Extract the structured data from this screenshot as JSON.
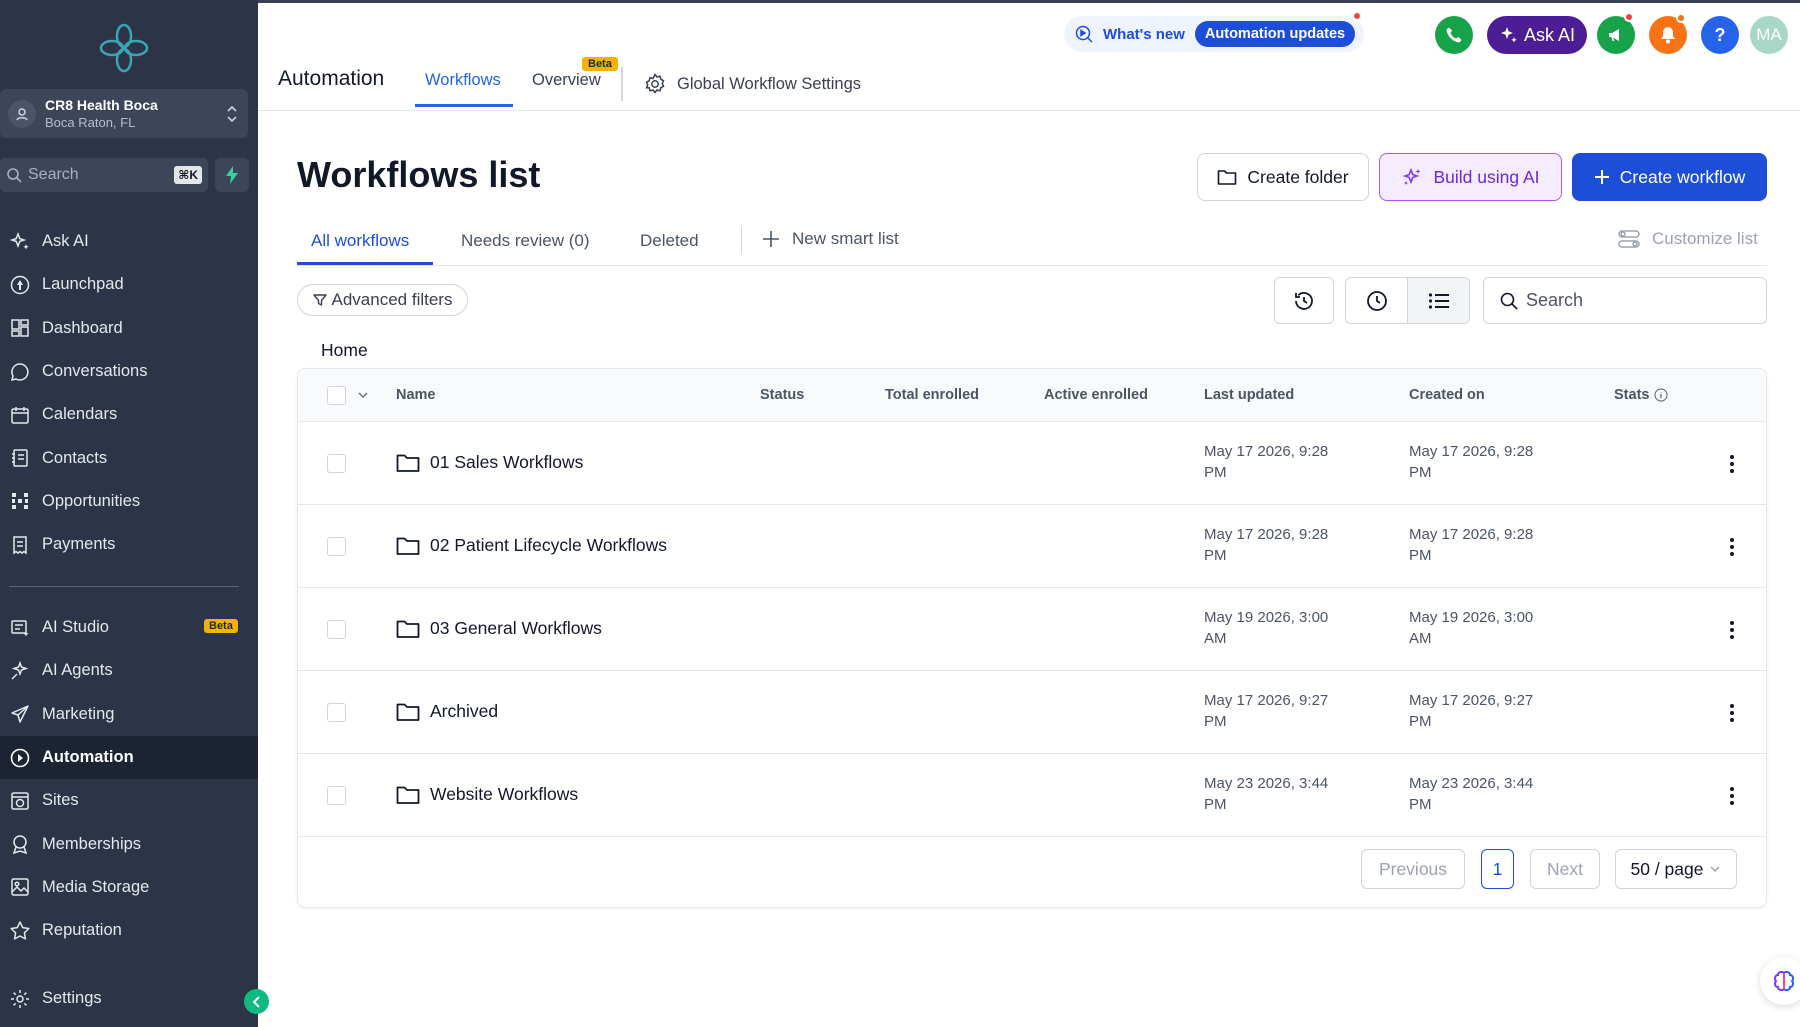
{
  "sidebar": {
    "location": {
      "name": "CR8 Health Boca",
      "city": "Boca Raton, FL"
    },
    "search": {
      "label": "Search",
      "shortcut": "⌘K"
    },
    "items": [
      {
        "label": "Ask AI",
        "icon": "sparkles-icon"
      },
      {
        "label": "Launchpad",
        "icon": "rocket-icon"
      },
      {
        "label": "Dashboard",
        "icon": "dashboard-grid-icon"
      },
      {
        "label": "Conversations",
        "icon": "chat-bubble-icon"
      },
      {
        "label": "Calendars",
        "icon": "calendar-icon"
      },
      {
        "label": "Contacts",
        "icon": "contacts-book-icon"
      },
      {
        "label": "Opportunities",
        "icon": "opportunities-icon"
      },
      {
        "label": "Payments",
        "icon": "receipt-icon"
      }
    ],
    "items2": [
      {
        "label": "AI Studio",
        "icon": "ai-studio-icon",
        "badge": "Beta"
      },
      {
        "label": "AI Agents",
        "icon": "ai-agents-icon"
      },
      {
        "label": "Marketing",
        "icon": "paper-plane-icon"
      },
      {
        "label": "Automation",
        "icon": "automation-icon",
        "active": true
      },
      {
        "label": "Sites",
        "icon": "globe-window-icon"
      },
      {
        "label": "Memberships",
        "icon": "award-icon"
      },
      {
        "label": "Media Storage",
        "icon": "image-icon"
      },
      {
        "label": "Reputation",
        "icon": "star-icon"
      }
    ],
    "settings": {
      "label": "Settings",
      "icon": "gear-icon"
    }
  },
  "topbar": {
    "title": "Automation",
    "tabs": [
      {
        "label": "Workflows",
        "active": true
      },
      {
        "label": "Overview",
        "badge": "Beta"
      }
    ],
    "global_settings": "Global Workflow Settings",
    "whats_new": "What's new",
    "automation_updates": "Automation updates",
    "ask_ai": "Ask AI",
    "help": "?",
    "user_initials": "MA"
  },
  "page": {
    "title": "Workflows list",
    "buttons": {
      "create_folder": "Create folder",
      "build_ai": "Build using AI",
      "create_workflow": "Create workflow"
    },
    "subtabs": [
      "All workflows",
      "Needs review (0)",
      "Deleted"
    ],
    "new_smart_list": "New smart list",
    "customize_list": "Customize list",
    "advanced_filters": "Advanced filters",
    "search_placeholder": "Search",
    "breadcrumb": "Home"
  },
  "table": {
    "columns": {
      "name": "Name",
      "status": "Status",
      "total": "Total enrolled",
      "active": "Active enrolled",
      "updated": "Last updated",
      "created": "Created on",
      "stats": "Stats"
    },
    "rows": [
      {
        "name": "01 Sales Workflows",
        "updated": "May 17 2026, 9:28 PM",
        "created": "May 17 2026, 9:28 PM"
      },
      {
        "name": "02 Patient Lifecycle Workflows",
        "updated": "May 17 2026, 9:28 PM",
        "created": "May 17 2026, 9:28 PM"
      },
      {
        "name": "03 General Workflows",
        "updated": "May 19 2026, 3:00 AM",
        "created": "May 19 2026, 3:00 AM"
      },
      {
        "name": "Archived",
        "updated": "May 17 2026, 9:27 PM",
        "created": "May 17 2026, 9:27 PM"
      },
      {
        "name": "Website Workflows",
        "updated": "May 23 2026, 3:44 PM",
        "created": "May 23 2026, 3:44 PM"
      }
    ],
    "pagination": {
      "previous": "Previous",
      "current": "1",
      "next": "Next",
      "page_size": "50 / page"
    }
  },
  "colors": {
    "sidebar_bg": "#2b3547",
    "accent": "#1d4ed8",
    "ai_purple": "#4c1d95",
    "beta": "#f5b301",
    "phone_green": "#16a34a",
    "bell_orange": "#f97316"
  }
}
